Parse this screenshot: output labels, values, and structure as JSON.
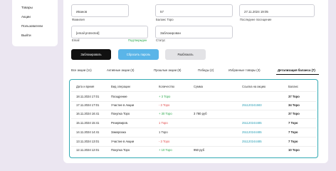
{
  "sidebar": {
    "items": [
      {
        "label": "Товары"
      },
      {
        "label": "Акции"
      },
      {
        "label": "Пользователи"
      },
      {
        "label": "Выйти"
      }
    ]
  },
  "form": {
    "surname": {
      "value": "Иванов",
      "label": "Фамилия"
    },
    "balance": {
      "value": "57",
      "label": "Баланс Торо"
    },
    "last_visit": {
      "value": "27.11.2024 19:05",
      "label": "Последнее посещение"
    },
    "email": {
      "value": "[email protected]",
      "label": "Email",
      "confirmed": "Подтвержден"
    },
    "status": {
      "value": "Заблокирован",
      "label": "Статус"
    }
  },
  "buttons": {
    "block": "Заблокировать",
    "reset_password": "Сбросить пароль",
    "unblock": "Разблокать"
  },
  "tabs": [
    {
      "label": "Все акции",
      "count": "(11)"
    },
    {
      "label": "Активные акции",
      "count": "(3)"
    },
    {
      "label": "Прошлые акции",
      "count": "(8)"
    },
    {
      "label": "Победы",
      "count": "(2)"
    },
    {
      "label": "Избранные товары",
      "count": "(3)"
    },
    {
      "label": "Детализация баланса",
      "count": "(7)"
    }
  ],
  "table": {
    "headers": [
      "Дата и время",
      "Вид операции",
      "Количество",
      "Сумма",
      "Ссылка на акцию",
      "Баланс"
    ],
    "rows": [
      {
        "date": "18.11.2024 17:01",
        "op": "Поощрение",
        "qty": "+ 3 Торо",
        "qty_sign": "plus",
        "sum": "",
        "link": "",
        "bal": "37 Торо"
      },
      {
        "date": "17.11.2024 17:01",
        "op": "Участие в Акции",
        "qty": "- 3 Торо",
        "qty_sign": "minus",
        "sum": "",
        "link": "251120241583",
        "bal": "34 Торо"
      },
      {
        "date": "16.11.2024 16:41",
        "op": "Покупка Торо",
        "qty": "+ 30 Торо",
        "qty_sign": "plus",
        "sum": "3 780 руб",
        "link": "",
        "bal": "37 Торо"
      },
      {
        "date": "15.11.2024 15:41",
        "op": "Резервиров.",
        "qty": "1 Торо",
        "qty_sign": "minus",
        "sum": "",
        "link": "251120244485",
        "bal": "7 Торо"
      },
      {
        "date": "14.11.2024 14:41",
        "op": "Заморозка",
        "qty": "1 Торо",
        "qty_sign": "neutral",
        "sum": "",
        "link": "251120244485",
        "bal": "7 Торо"
      },
      {
        "date": "13.11.2024 13:01",
        "op": "Участие в Акции",
        "qty": "- 3 Торо",
        "qty_sign": "minus",
        "sum": "",
        "link": "251120244485",
        "bal": "7 Торо"
      },
      {
        "date": "12.11.2024 12:01",
        "op": "Покупка Торо",
        "qty": "+ 10 Торо",
        "qty_sign": "plus",
        "sum": "950 руб",
        "link": "",
        "bal": "10 Торо"
      }
    ]
  }
}
